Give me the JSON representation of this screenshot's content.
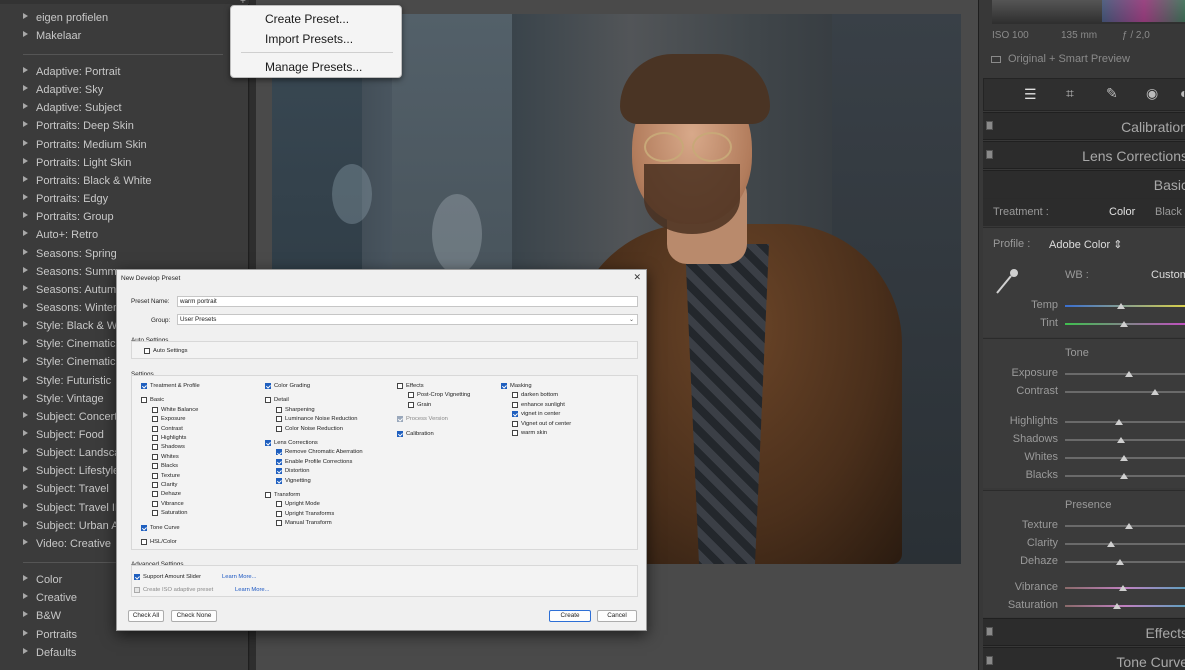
{
  "left_panel": {
    "items_top": [
      "eigen profielen",
      "Makelaar"
    ],
    "items": [
      "Adaptive: Portrait",
      "Adaptive: Sky",
      "Adaptive: Subject",
      "Portraits: Deep Skin",
      "Portraits: Medium Skin",
      "Portraits: Light Skin",
      "Portraits: Black & White",
      "Portraits: Edgy",
      "Portraits: Group",
      "Auto+: Retro",
      "Seasons: Spring",
      "Seasons: Summer",
      "Seasons: Autumn",
      "Seasons: Winter",
      "Style: Black & White",
      "Style: Cinematic",
      "Style: Cinematic II",
      "Style: Futuristic",
      "Style: Vintage",
      "Subject: Concerts",
      "Subject: Food",
      "Subject: Landscape",
      "Subject: Lifestyle",
      "Subject: Travel",
      "Subject: Travel II",
      "Subject: Urban Architecture",
      "Video: Creative"
    ],
    "items_bottom": [
      "Color",
      "Creative",
      "B&W",
      "Portraits",
      "Defaults"
    ]
  },
  "preset_menu": {
    "create": "Create Preset...",
    "import": "Import Presets...",
    "manage": "Manage Presets..."
  },
  "dialog": {
    "title": "New Develop Preset",
    "preset_name_label": "Preset Name:",
    "preset_name_value": "warm portrait",
    "group_label": "Group:",
    "group_value": "User Presets",
    "auto_settings_heading": "Auto Settings",
    "auto_settings_cb": "Auto Settings",
    "settings_heading": "Settings",
    "col1": [
      {
        "label": "Treatment & Profile",
        "on": true,
        "indent": 0
      },
      {
        "label": "Basic",
        "on": false,
        "indent": 0,
        "gap": true
      },
      {
        "label": "White Balance",
        "on": false,
        "indent": 1
      },
      {
        "label": "Exposure",
        "on": false,
        "indent": 1
      },
      {
        "label": "Contrast",
        "on": false,
        "indent": 1
      },
      {
        "label": "Highlights",
        "on": false,
        "indent": 1
      },
      {
        "label": "Shadows",
        "on": false,
        "indent": 1
      },
      {
        "label": "Whites",
        "on": false,
        "indent": 1
      },
      {
        "label": "Blacks",
        "on": false,
        "indent": 1
      },
      {
        "label": "Texture",
        "on": false,
        "indent": 1
      },
      {
        "label": "Clarity",
        "on": false,
        "indent": 1
      },
      {
        "label": "Dehaze",
        "on": false,
        "indent": 1
      },
      {
        "label": "Vibrance",
        "on": false,
        "indent": 1
      },
      {
        "label": "Saturation",
        "on": false,
        "indent": 1
      },
      {
        "label": "Tone Curve",
        "on": true,
        "indent": 0,
        "gap": true
      },
      {
        "label": "HSL/Color",
        "on": false,
        "indent": 0,
        "gap": true
      }
    ],
    "col2": [
      {
        "label": "Color Grading",
        "on": true,
        "indent": 0
      },
      {
        "label": "Detail",
        "on": false,
        "indent": 0,
        "gap": true
      },
      {
        "label": "Sharpening",
        "on": false,
        "indent": 1
      },
      {
        "label": "Luminance Noise Reduction",
        "on": false,
        "indent": 1
      },
      {
        "label": "Color Noise Reduction",
        "on": false,
        "indent": 1
      },
      {
        "label": "Lens Corrections",
        "on": true,
        "indent": 0,
        "gap": true
      },
      {
        "label": "Remove Chromatic Aberration",
        "on": true,
        "indent": 1
      },
      {
        "label": "Enable Profile Corrections",
        "on": true,
        "indent": 1
      },
      {
        "label": "Distortion",
        "on": true,
        "indent": 1
      },
      {
        "label": "Vignetting",
        "on": true,
        "indent": 1
      },
      {
        "label": "Transform",
        "on": false,
        "indent": 0,
        "gap": true
      },
      {
        "label": "Upright Mode",
        "on": false,
        "indent": 1
      },
      {
        "label": "Upright Transforms",
        "on": false,
        "indent": 1
      },
      {
        "label": "Manual Transform",
        "on": false,
        "indent": 1
      }
    ],
    "col3": [
      {
        "label": "Effects",
        "on": false,
        "indent": 0
      },
      {
        "label": "Post-Crop Vignetting",
        "on": false,
        "indent": 1
      },
      {
        "label": "Grain",
        "on": false,
        "indent": 1
      },
      {
        "label": "Process Version",
        "on": true,
        "indent": 0,
        "gap": true,
        "disabled": true
      },
      {
        "label": "Calibration",
        "on": true,
        "indent": 0,
        "gap": true
      }
    ],
    "col4": [
      {
        "label": "Masking",
        "on": true,
        "indent": 0
      },
      {
        "label": "darken bottom",
        "on": false,
        "indent": 1
      },
      {
        "label": "enhance sunlight",
        "on": false,
        "indent": 1
      },
      {
        "label": "vignet in center",
        "on": true,
        "indent": 1
      },
      {
        "label": "Vignet out of center",
        "on": false,
        "indent": 1
      },
      {
        "label": "warm skin",
        "on": false,
        "indent": 1
      }
    ],
    "advanced_heading": "Advanced Settings",
    "support_amount": "Support Amount Slider",
    "iso_adaptive": "Create ISO adaptive preset",
    "learn_more": "Learn More...",
    "check_all": "Check All",
    "check_none": "Check None",
    "create": "Create",
    "cancel": "Cancel"
  },
  "right_panel": {
    "iso": "ISO 100",
    "focal": "135 mm",
    "aperture": "ƒ / 2,0",
    "preview": "Original + Smart Preview",
    "calibration": "Calibration",
    "lens": "Lens Corrections",
    "basic": "Basic",
    "treatment_label": "Treatment :",
    "treatment_color": "Color",
    "treatment_bw": "Black & White",
    "profile_label": "Profile :",
    "profile_value": "Adobe Color",
    "wb_label": "WB :",
    "wb_value": "Custom",
    "temp": "Temp",
    "tint": "Tint",
    "tone": "Tone",
    "exposure": "Exposure",
    "contrast": "Contrast",
    "highlights": "Highlights",
    "shadows": "Shadows",
    "whites": "Whites",
    "blacks": "Blacks",
    "presence": "Presence",
    "texture": "Texture",
    "clarity": "Clarity",
    "dehaze": "Dehaze",
    "vibrance": "Vibrance",
    "saturation": "Saturation",
    "effects": "Effects",
    "tone_curve": "Tone Curve",
    "slider_values": {
      "temp": 0.47,
      "tint": 0.49,
      "exposure": 0.53,
      "contrast": 0.75,
      "highlights": 0.45,
      "shadows": 0.47,
      "whites": 0.49,
      "blacks": 0.49,
      "texture": 0.53,
      "clarity": 0.38,
      "dehaze": 0.46,
      "vibrance": 0.48,
      "saturation": 0.43
    }
  }
}
